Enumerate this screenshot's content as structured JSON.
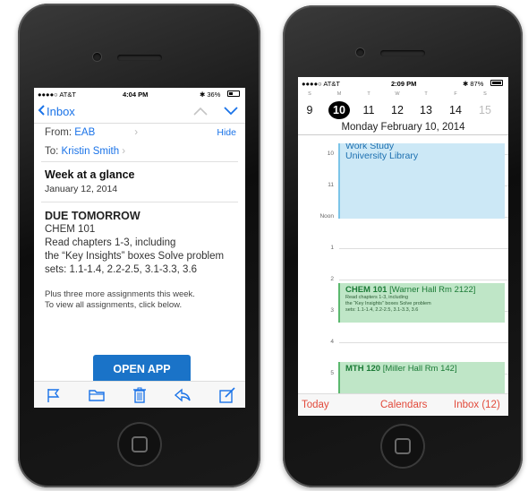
{
  "left_phone": {
    "status": {
      "carrier": "●●●●○ AT&T",
      "time": "4:04 PM",
      "battery": "✱ 36%",
      "battery_level": 0.36
    },
    "nav": {
      "back_label": "Inbox"
    },
    "from_label": "From:",
    "from_value": "EAB",
    "hide_label": "Hide",
    "to_label": "To:",
    "to_value": "Kristin Smith",
    "subject": "Week at a glance",
    "subject_date": "January 12, 2014",
    "body_heading": "DUE TOMORROW",
    "body_course": "CHEM 101",
    "body_line1": "Read chapters 1-3, including",
    "body_line2": "the “Key Insights” boxes Solve problem",
    "body_line3": "sets: 1.1-1.4, 2.2-2.5, 3.1-3.3, 3.6",
    "small_line1": "Plus three more assignments this week.",
    "small_line2": "To view all assignments, click below.",
    "open_app_label": "OPEN APP",
    "toolbar_icons": [
      "flag-icon",
      "folder-icon",
      "trash-icon",
      "reply-icon",
      "compose-icon"
    ]
  },
  "right_phone": {
    "status": {
      "carrier": "●●●●○ AT&T",
      "time": "2:09 PM",
      "battery": "✱ 87%",
      "battery_level": 0.87
    },
    "week_letters": [
      "S",
      "M",
      "T",
      "W",
      "T",
      "F",
      "S"
    ],
    "week_days": [
      "9",
      "10",
      "11",
      "12",
      "13",
      "14",
      "15"
    ],
    "selected_day": "10",
    "day_title": "Monday  February 10, 2014",
    "hours": [
      "10",
      "11",
      "Noon",
      "1",
      "2",
      "3",
      "4",
      "5"
    ],
    "events": {
      "work_title": "Work Study",
      "work_location": "University Library",
      "chem_course": "CHEM 101",
      "chem_room": " [Warner Hall Rm 2122]",
      "chem_line1": "Read chapters 1-3, including",
      "chem_line2": "the “Key Insights” boxes Solve problem",
      "chem_line3": "sets: 1.1-1.4, 2.2-2.5, 3.1-3.3, 3.6",
      "mth_course": "MTH 120",
      "mth_room": " [Miller Hall Rm 142]"
    },
    "bottom": {
      "today": "Today",
      "calendars": "Calendars",
      "inbox": "Inbox (12)"
    },
    "accent_color": "#e24a3b"
  },
  "colors": {
    "link_blue": "#1a73e8",
    "button_blue": "#1a73c8",
    "event_blue": "#cce8f6",
    "event_green": "#bfe6c7"
  }
}
